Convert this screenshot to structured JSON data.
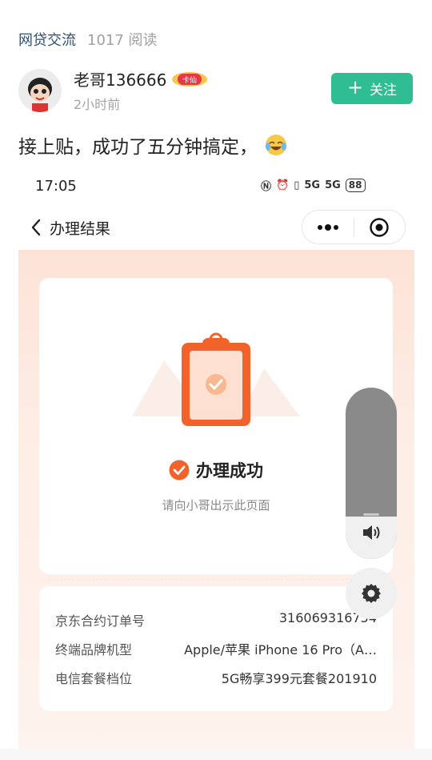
{
  "forum": {
    "name": "网贷交流",
    "reads": "1017 阅读"
  },
  "author": {
    "name": "老哥136666",
    "badge": "卡仙",
    "time": "2小时前"
  },
  "follow_button": {
    "label": "关注"
  },
  "post": {
    "text": "接上贴，成功了五分钟搞定，"
  },
  "status_bar": {
    "time": "17:05",
    "battery": "88",
    "network": "5G"
  },
  "mini_app": {
    "title": "办理结果"
  },
  "result": {
    "status": "办理成功",
    "hint": "请向小哥出示此页面"
  },
  "details": [
    {
      "label": "京东合约订单号",
      "value": "316069316754"
    },
    {
      "label": "终端品牌机型",
      "value": "Apple/苹果 iPhone 16 Pro（A…"
    },
    {
      "label": "电信套餐档位",
      "value": "5G畅享399元套餐201910"
    }
  ],
  "volume": {
    "level": 0.25
  },
  "colors": {
    "accent_green": "#2fbd92",
    "orange": "#f4622c",
    "forum_blue": "#2f4f78"
  },
  "icons": [
    "back-icon",
    "more-icon",
    "close-target-icon",
    "check-circle-icon",
    "volume-icon",
    "gear-icon"
  ]
}
